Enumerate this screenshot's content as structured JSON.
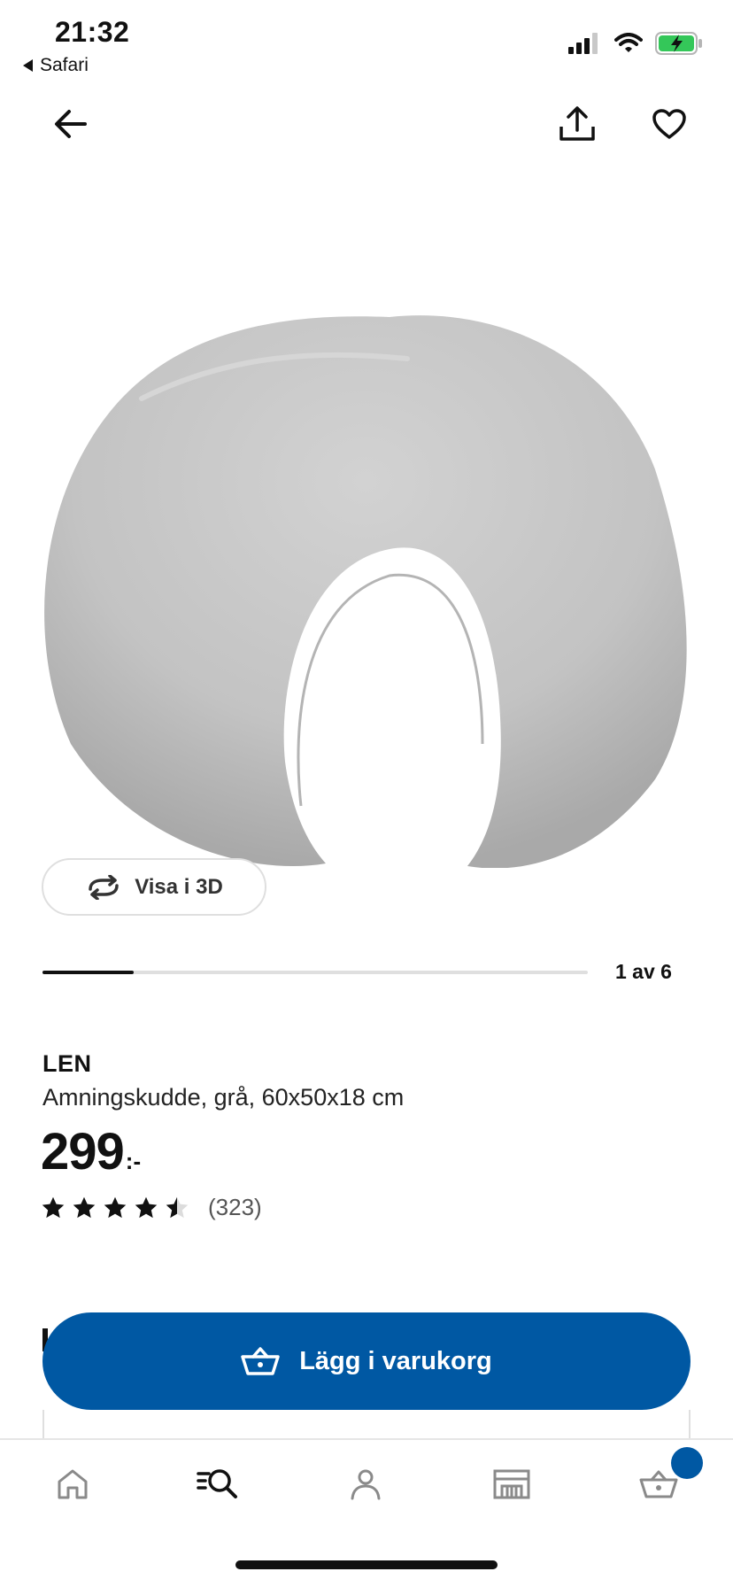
{
  "status_bar": {
    "time": "21:32",
    "back_app_label": "Safari",
    "icons": [
      "cellular-signal-icon",
      "wifi-icon",
      "battery-charging-icon"
    ]
  },
  "top_bar": {
    "icons": [
      "arrow-left-icon",
      "share-icon",
      "heart-icon"
    ]
  },
  "gallery": {
    "view_3d_label": "Visa i 3D",
    "counter": "1 av 6",
    "current": 1,
    "total": 6
  },
  "product": {
    "brand": "LEN",
    "description": "Amningskudde, grå, 60x50x18 cm",
    "price": "299",
    "price_suffix": ":-",
    "rating": 4.5,
    "rating_max": 5,
    "review_count": "(323)"
  },
  "actions": {
    "add_to_cart_label": "Lägg i varukorg"
  },
  "bottom_nav": {
    "items": [
      "home-icon",
      "search-list-icon",
      "profile-icon",
      "store-icon",
      "cart-icon"
    ],
    "cart_badge_color": "#0058a3"
  },
  "colors": {
    "accent": "#0058a3",
    "battery": "#34c759"
  }
}
